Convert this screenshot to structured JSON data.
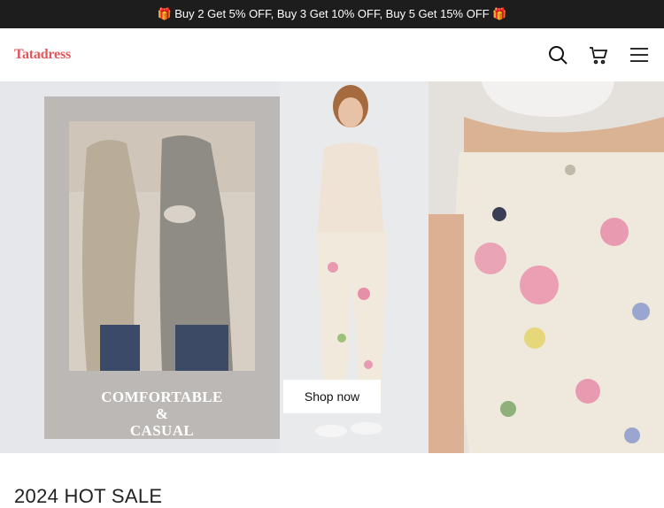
{
  "promo": {
    "text": "🎁 Buy 2 Get 5% OFF, Buy 3 Get 10% OFF, Buy 5 Get 15% OFF 🎁"
  },
  "header": {
    "logo": "Tatadress",
    "icons": [
      "search-icon",
      "cart-icon",
      "menu-icon"
    ]
  },
  "hero": {
    "line1": "COMFORTABLE",
    "line2": "&",
    "line3": "CASUAL",
    "button_label": "Shop now"
  },
  "section": {
    "title": "2024 HOT SALE"
  }
}
